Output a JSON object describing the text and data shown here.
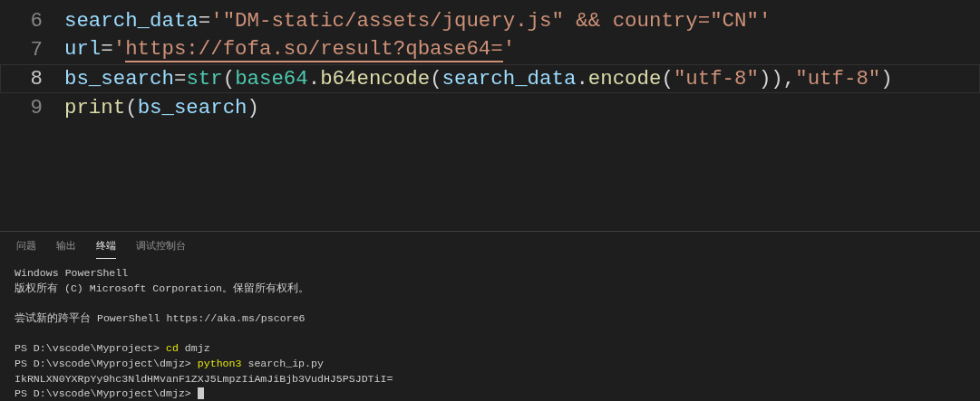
{
  "editor": {
    "lines": [
      {
        "number": "6",
        "current": false,
        "tokens": [
          {
            "kind": "var",
            "text": "search_data"
          },
          {
            "kind": "op",
            "text": "="
          },
          {
            "kind": "str",
            "text": "'\"DM-static/assets/jquery.js\" && country=\"CN\"'"
          }
        ]
      },
      {
        "number": "7",
        "current": false,
        "tokens": [
          {
            "kind": "var",
            "text": "url"
          },
          {
            "kind": "op",
            "text": "="
          },
          {
            "kind": "str",
            "text": "'"
          },
          {
            "kind": "str",
            "text": "https://fofa.so/result?qbase64=",
            "underlined": true
          },
          {
            "kind": "str",
            "text": "'"
          }
        ]
      },
      {
        "number": "8",
        "current": true,
        "tokens": [
          {
            "kind": "var",
            "text": "bs_search"
          },
          {
            "kind": "op",
            "text": "="
          },
          {
            "kind": "cls",
            "text": "str"
          },
          {
            "kind": "op",
            "text": "("
          },
          {
            "kind": "cls",
            "text": "base64"
          },
          {
            "kind": "op",
            "text": "."
          },
          {
            "kind": "func",
            "text": "b64encode"
          },
          {
            "kind": "op",
            "text": "("
          },
          {
            "kind": "var",
            "text": "search_data"
          },
          {
            "kind": "op",
            "text": "."
          },
          {
            "kind": "func",
            "text": "encode"
          },
          {
            "kind": "op",
            "text": "("
          },
          {
            "kind": "str",
            "text": "\"utf-8\""
          },
          {
            "kind": "op",
            "text": ")),"
          },
          {
            "kind": "str",
            "text": "\"utf-8\""
          },
          {
            "kind": "op",
            "text": ")"
          }
        ]
      },
      {
        "number": "9",
        "current": false,
        "tokens": [
          {
            "kind": "func",
            "text": "print"
          },
          {
            "kind": "op",
            "text": "("
          },
          {
            "kind": "var",
            "text": "bs_search"
          },
          {
            "kind": "op",
            "text": ")"
          }
        ]
      }
    ]
  },
  "panel": {
    "tabs": [
      {
        "label": "问题",
        "selected": false
      },
      {
        "label": "输出",
        "selected": false
      },
      {
        "label": "终端",
        "selected": true
      },
      {
        "label": "调试控制台",
        "selected": false
      }
    ],
    "terminal_blocks": [
      [
        {
          "segments": [
            {
              "kind": "plain",
              "text": "Windows PowerShell"
            }
          ]
        },
        {
          "segments": [
            {
              "kind": "plain",
              "text": "版权所有 (C) Microsoft Corporation。保留所有权利。"
            }
          ]
        }
      ],
      [
        {
          "segments": [
            {
              "kind": "plain",
              "text": "尝试新的跨平台 PowerShell https://aka.ms/pscore6"
            }
          ]
        }
      ],
      [
        {
          "segments": [
            {
              "kind": "plain",
              "text": "PS D:\\vscode\\Myproject> "
            },
            {
              "kind": "cmd",
              "text": "cd"
            },
            {
              "kind": "plain",
              "text": " dmjz"
            }
          ]
        },
        {
          "segments": [
            {
              "kind": "plain",
              "text": "PS D:\\vscode\\Myproject\\dmjz> "
            },
            {
              "kind": "cmd",
              "text": "python3"
            },
            {
              "kind": "plain",
              "text": " search_ip.py"
            }
          ]
        },
        {
          "segments": [
            {
              "kind": "plain",
              "text": "IkRNLXN0YXRpYy9hc3NldHMvanF1ZXJ5LmpzIiAmJiBjb3VudHJ5PSJDTiI="
            }
          ]
        },
        {
          "segments": [
            {
              "kind": "plain",
              "text": "PS D:\\vscode\\Myproject\\dmjz> "
            }
          ],
          "cursor": true
        }
      ]
    ]
  }
}
